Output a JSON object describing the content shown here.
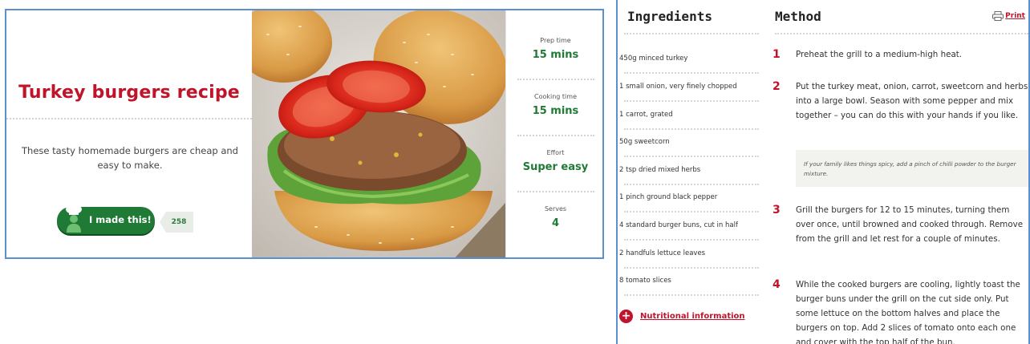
{
  "recipe": {
    "title": "Turkey burgers recipe",
    "description": "These tasty homemade burgers are cheap and easy to make.",
    "made_this_label": "I made this!",
    "made_count": "258"
  },
  "stats": [
    {
      "label": "Prep time",
      "value": "15 mins"
    },
    {
      "label": "Cooking time",
      "value": "15 mins"
    },
    {
      "label": "Effort",
      "value": "Super easy"
    },
    {
      "label": "Serves",
      "value": "4"
    }
  ],
  "ingredients": {
    "title": "Ingredients",
    "items": [
      "450g minced turkey",
      "1 small onion, very finely chopped",
      "1 carrot, grated",
      "50g sweetcorn",
      "2 tsp dried mixed herbs",
      "1 pinch ground black pepper",
      "4 standard burger buns, cut in half",
      "2 handfuls lettuce leaves",
      "8 tomato slices"
    ],
    "nutrition_link": "Nutritional information"
  },
  "method": {
    "title": "Method",
    "print_label": "Print",
    "steps": [
      {
        "number": "1",
        "text": "Preheat the grill to a medium-high heat."
      },
      {
        "number": "2",
        "text": "Put the turkey meat, onion, carrot, sweetcorn and herbs into a large bowl. Season with some pepper and mix together – you can do this with your hands if you like."
      },
      {
        "number": "3",
        "text": "Grill the burgers for 12 to 15 minutes, turning them over once, until browned and cooked through. Remove from the grill and let rest for a couple of minutes."
      },
      {
        "number": "4",
        "text": "While the cooked burgers are cooling, lightly toast the burger buns under the grill on the cut side only. Put some lettuce on the bottom halves and place the burgers on top. Add 2 slices of tomato onto each one and cover with the top half of the bun."
      }
    ],
    "tip": "If your family likes things spicy, add a pinch of chilli powder to the burger mixture."
  },
  "colors": {
    "brand_red": "#c0142b",
    "brand_green": "#1f7a35",
    "frame_blue": "#5b8fd0"
  },
  "icons": [
    "chef-icon",
    "printer-icon",
    "plus-circle-icon"
  ]
}
